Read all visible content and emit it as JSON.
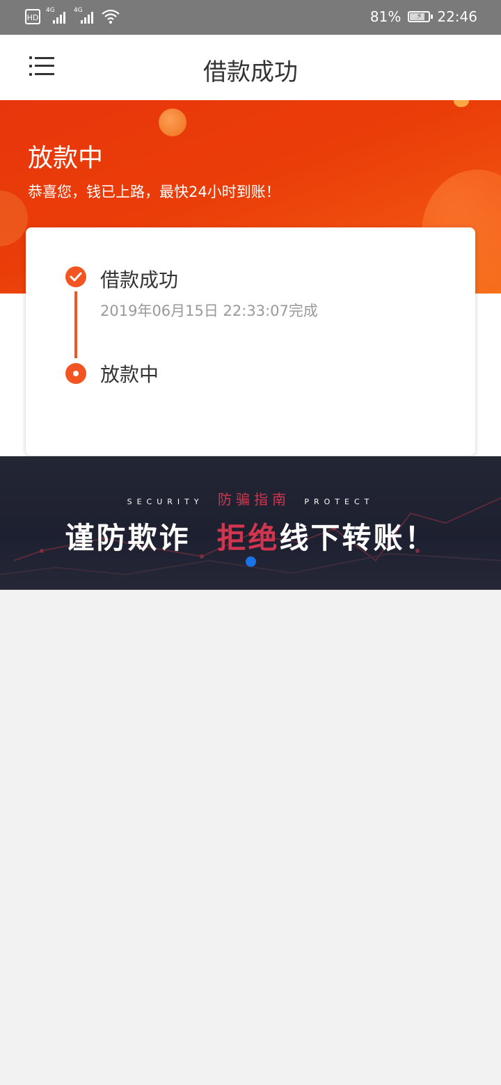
{
  "status_bar": {
    "hd_label": "HD",
    "net1_label": "4G",
    "net2_label": "4G",
    "battery_percent": "81%",
    "battery_level": 0.81,
    "time": "22:46"
  },
  "nav": {
    "title": "借款成功",
    "menu_icon": "menu-icon"
  },
  "hero": {
    "title": "放款中",
    "subtitle": "恭喜您，钱已上路，最快24小时到账！"
  },
  "steps": [
    {
      "label": "借款成功",
      "time": "2019年06月15日 22:33:07完成",
      "icon": "check-circle-icon"
    },
    {
      "label": "放款中",
      "icon": "in-progress-dot-icon"
    }
  ],
  "banner": {
    "en_left": "SECURITY",
    "cn_small": "防骗指南",
    "en_right": "PROTECT",
    "line_part1": "谨防欺诈",
    "line_part2_red": "拒绝",
    "line_part3": "线下转账！",
    "accent_color": "#d0364f",
    "pager_active_color": "#1a73e8"
  },
  "colors": {
    "hero_orange": "#e8360c",
    "step_orange": "#f25522",
    "page_bg": "#f2f2f2"
  }
}
